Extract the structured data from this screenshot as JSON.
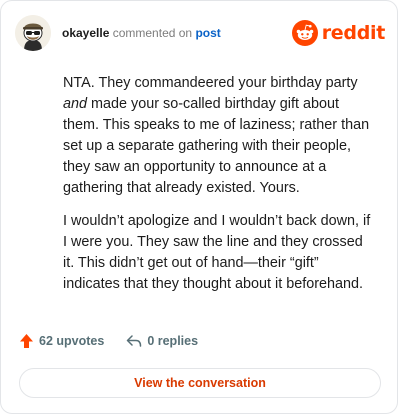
{
  "header": {
    "username": "okayelle",
    "action_text": "commented on",
    "link_text": "post",
    "brand": "reddit"
  },
  "comment": {
    "p1_part1": "NTA. They commandeered your birthday party ",
    "p1_emphasis": "and",
    "p1_part2": " made your so-called birthday gift about them. This speaks to me of laziness; rather than set up a separate gathering with their people, they saw an opportunity to announce at a gathering that already existed. Yours.",
    "p2": "I wouldn’t apologize and I wouldn’t back down, if I were you. They saw the line and they crossed it. This didn’t get out of hand—their “gift” indicates that they thought about it beforehand."
  },
  "stats": {
    "upvotes": "62 upvotes",
    "replies": "0 replies"
  },
  "cta": {
    "label": "View the conversation"
  },
  "colors": {
    "brand": "#ff4500",
    "link": "#0a62c7",
    "cta": "#d93a00"
  },
  "icons": {
    "avatar": "snoo-avatar",
    "brand": "reddit-logo-icon",
    "upvote": "upvote-arrow-icon",
    "reply": "reply-arrow-icon"
  }
}
